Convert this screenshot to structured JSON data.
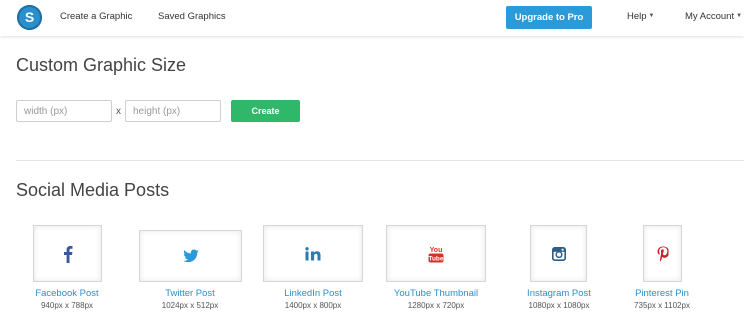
{
  "navbar": {
    "logo_letter": "S",
    "create_label": "Create a Graphic",
    "saved_label": "Saved Graphics",
    "upgrade_label": "Upgrade to Pro",
    "help_label": "Help",
    "account_label": "My Account"
  },
  "custom": {
    "title": "Custom Graphic Size",
    "width_placeholder": "width (px)",
    "height_placeholder": "height (px)",
    "separator": "x",
    "create_label": "Create"
  },
  "social": {
    "title": "Social Media Posts",
    "items": [
      {
        "label": "Facebook Post",
        "size": "940px x 788px",
        "icon": "facebook-icon"
      },
      {
        "label": "Twitter Post",
        "size": "1024px x 512px",
        "icon": "twitter-icon"
      },
      {
        "label": "LinkedIn Post",
        "size": "1400px x 800px",
        "icon": "linkedin-icon"
      },
      {
        "label": "YouTube Thumbnail",
        "size": "1280px x 720px",
        "icon": "youtube-icon"
      },
      {
        "label": "Instagram Post",
        "size": "1080px x 1080px",
        "icon": "instagram-icon"
      },
      {
        "label": "Pinterest Pin",
        "size": "735px x 1102px",
        "icon": "pinterest-icon"
      }
    ]
  },
  "colors": {
    "brand_blue": "#2a8fcb",
    "upgrade_blue": "#2a9ad9",
    "create_green": "#2fb86a",
    "facebook": "#3b5998",
    "twitter": "#2a9ad9",
    "linkedin": "#2a7bb5",
    "youtube": "#d8322a",
    "instagram": "#2e5e86",
    "pinterest": "#c8232c"
  }
}
